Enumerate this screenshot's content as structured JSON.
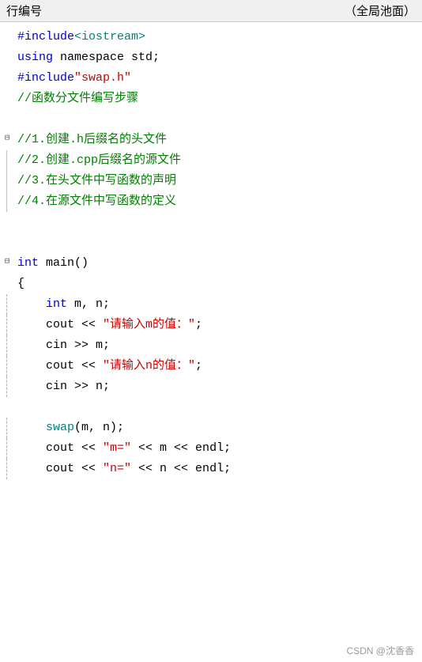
{
  "header": {
    "left": "行编号",
    "right": "（全局池面）"
  },
  "lines": [
    {
      "id": 1,
      "fold": false,
      "indent": 0,
      "tokens": [
        {
          "text": "#include",
          "color": "blue"
        },
        {
          "text": "<iostream>",
          "color": "teal"
        }
      ]
    },
    {
      "id": 2,
      "fold": false,
      "indent": 0,
      "tokens": [
        {
          "text": "using",
          "color": "blue"
        },
        {
          "text": " namespace std;",
          "color": "black"
        }
      ]
    },
    {
      "id": 3,
      "fold": false,
      "indent": 0,
      "tokens": [
        {
          "text": "#include",
          "color": "blue"
        },
        {
          "text": "″swap.h″",
          "color": "red"
        }
      ]
    },
    {
      "id": 4,
      "fold": false,
      "indent": 0,
      "tokens": [
        {
          "text": "//函数分文件编写步骤",
          "color": "green"
        }
      ]
    },
    {
      "id": 5,
      "fold": false,
      "indent": 0,
      "tokens": []
    },
    {
      "id": 6,
      "fold": true,
      "indent": 0,
      "tokens": [
        {
          "text": "//1.创建.h后缀名的头文件",
          "color": "green"
        }
      ]
    },
    {
      "id": 7,
      "fold": false,
      "indent": 1,
      "tokens": [
        {
          "text": "//2.创建.cpp后缀名的源文件",
          "color": "green"
        }
      ]
    },
    {
      "id": 8,
      "fold": false,
      "indent": 1,
      "tokens": [
        {
          "text": "//3.在头文件中写函数的声明",
          "color": "green"
        }
      ]
    },
    {
      "id": 9,
      "fold": false,
      "indent": 1,
      "tokens": [
        {
          "text": "//4.在源文件中写函数的定义",
          "color": "green"
        }
      ]
    },
    {
      "id": 10,
      "fold": false,
      "indent": 0,
      "tokens": []
    },
    {
      "id": 11,
      "fold": false,
      "indent": 0,
      "tokens": []
    },
    {
      "id": 12,
      "fold": true,
      "indent": 0,
      "tokens": [
        {
          "text": "int",
          "color": "blue"
        },
        {
          "text": " main()",
          "color": "black"
        }
      ]
    },
    {
      "id": 13,
      "fold": false,
      "indent": 0,
      "tokens": [
        {
          "text": "{",
          "color": "black"
        }
      ]
    },
    {
      "id": 14,
      "fold": false,
      "indent": 1,
      "tokens": [
        {
          "text": "    ",
          "color": "black"
        },
        {
          "text": "int",
          "color": "blue"
        },
        {
          "text": " m, n;",
          "color": "black"
        }
      ]
    },
    {
      "id": 15,
      "fold": false,
      "indent": 1,
      "tokens": [
        {
          "text": "    cout << ",
          "color": "black"
        },
        {
          "text": "″请输入m的值：″",
          "color": "red"
        },
        {
          "text": ";",
          "color": "black"
        }
      ]
    },
    {
      "id": 16,
      "fold": false,
      "indent": 1,
      "tokens": [
        {
          "text": "    cin >> m;",
          "color": "black"
        }
      ]
    },
    {
      "id": 17,
      "fold": false,
      "indent": 1,
      "tokens": [
        {
          "text": "    cout << ",
          "color": "black"
        },
        {
          "text": "″请输入n的值：″",
          "color": "red"
        },
        {
          "text": ";",
          "color": "black"
        }
      ]
    },
    {
      "id": 18,
      "fold": false,
      "indent": 1,
      "tokens": [
        {
          "text": "    cin >> n;",
          "color": "black"
        }
      ]
    },
    {
      "id": 19,
      "fold": false,
      "indent": 0,
      "tokens": []
    },
    {
      "id": 20,
      "fold": false,
      "indent": 1,
      "tokens": [
        {
          "text": "    ",
          "color": "black"
        },
        {
          "text": "swap",
          "color": "teal"
        },
        {
          "text": "(m, n);",
          "color": "black"
        }
      ]
    },
    {
      "id": 21,
      "fold": false,
      "indent": 1,
      "tokens": [
        {
          "text": "    cout << ",
          "color": "black"
        },
        {
          "text": "″m=″",
          "color": "red"
        },
        {
          "text": " << m << endl;",
          "color": "black"
        }
      ]
    },
    {
      "id": 22,
      "fold": false,
      "indent": 1,
      "tokens": [
        {
          "text": "    cout << ",
          "color": "black"
        },
        {
          "text": "″n=″",
          "color": "red"
        },
        {
          "text": " << n << endl;",
          "color": "black"
        }
      ]
    }
  ],
  "watermark": "CSDN @沈香香"
}
